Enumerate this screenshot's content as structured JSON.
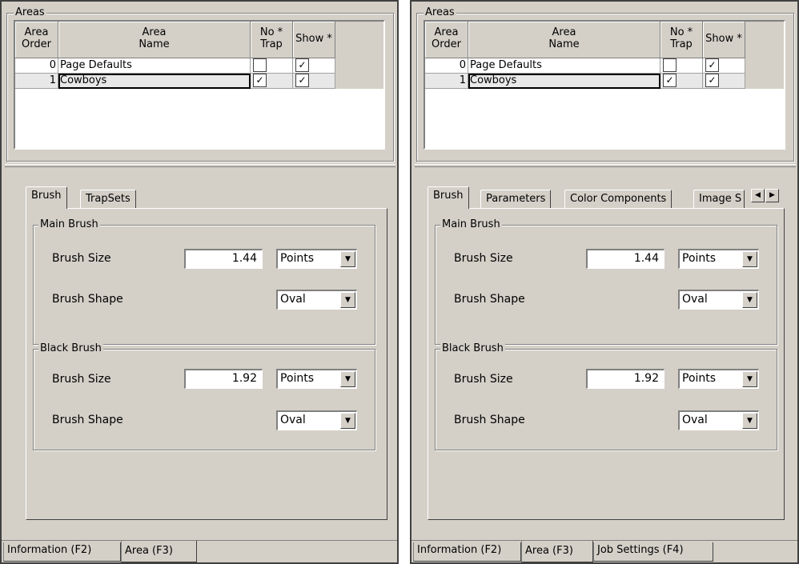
{
  "areas_group_title": "Areas",
  "grid": {
    "headers": {
      "order": [
        "Area",
        "Order"
      ],
      "name": [
        "Area",
        "Name"
      ],
      "notrap": [
        "No *",
        "Trap"
      ],
      "show": "Show *"
    },
    "rows": [
      {
        "order": "0",
        "name": "Page Defaults",
        "no_trap": false,
        "show": true
      },
      {
        "order": "1",
        "name": "Cowboys",
        "no_trap": true,
        "show": true
      }
    ],
    "check_glyph": "✓"
  },
  "left": {
    "tabs": [
      "Brush",
      "TrapSets"
    ]
  },
  "right": {
    "tabs": [
      "Brush",
      "Parameters",
      "Color Components",
      "Image S"
    ]
  },
  "main_brush": {
    "title": "Main Brush",
    "size_label": "Brush Size",
    "size_value": "1.44",
    "unit": "Points",
    "shape_label": "Brush Shape",
    "shape": "Oval"
  },
  "black_brush": {
    "title": "Black Brush",
    "size_label": "Brush Size",
    "size_value": "1.92",
    "unit": "Points",
    "shape_label": "Brush Shape",
    "shape": "Oval"
  },
  "bottom_tabs": {
    "information": "Information (F2)",
    "area": "Area (F3)",
    "job_settings": "Job Settings (F4)"
  },
  "icons": {
    "dropdown": "▼",
    "scroll_left": "◀",
    "scroll_right": "▶"
  }
}
